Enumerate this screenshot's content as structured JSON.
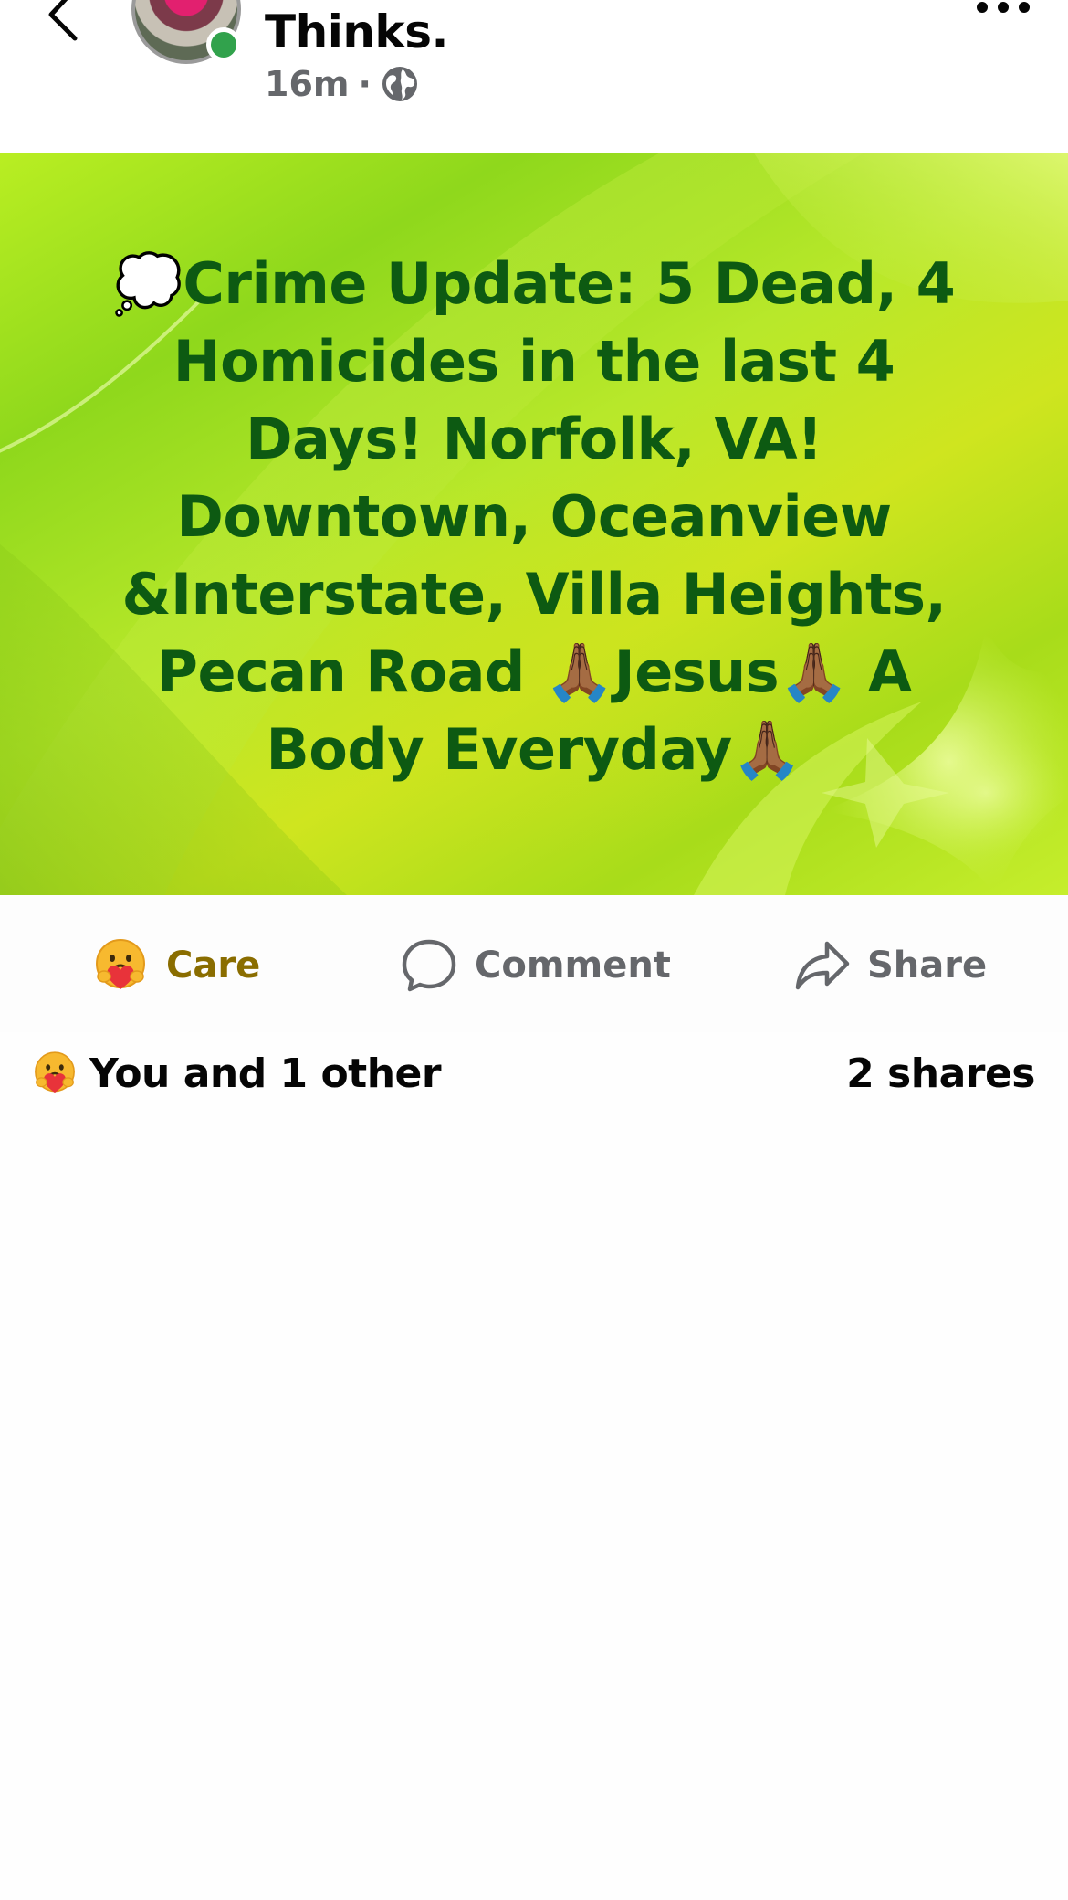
{
  "header": {
    "author_name": "Thinks.",
    "timestamp": "16m",
    "separator": "·",
    "privacy_icon": "globe-icon",
    "back_icon": "chevron-left-icon",
    "more_icon": "more-horizontal-icon"
  },
  "post": {
    "text": "💭Crime Update: 5 Dead, 4 Homicides in the last 4 Days! Norfolk, VA! Downtown, Oceanview &Interstate, Villa Heights, Pecan Road 🙏🏾Jesus🙏🏾 A Body Everyday🙏🏾",
    "text_color": "#0d5a12",
    "background_color": "#b8e82a"
  },
  "actions": {
    "care_label": "Care",
    "care_color": "#8a6d00",
    "comment_label": "Comment",
    "share_label": "Share"
  },
  "summary": {
    "reactions_text": "You and 1 other",
    "shares_text": "2 shares"
  }
}
